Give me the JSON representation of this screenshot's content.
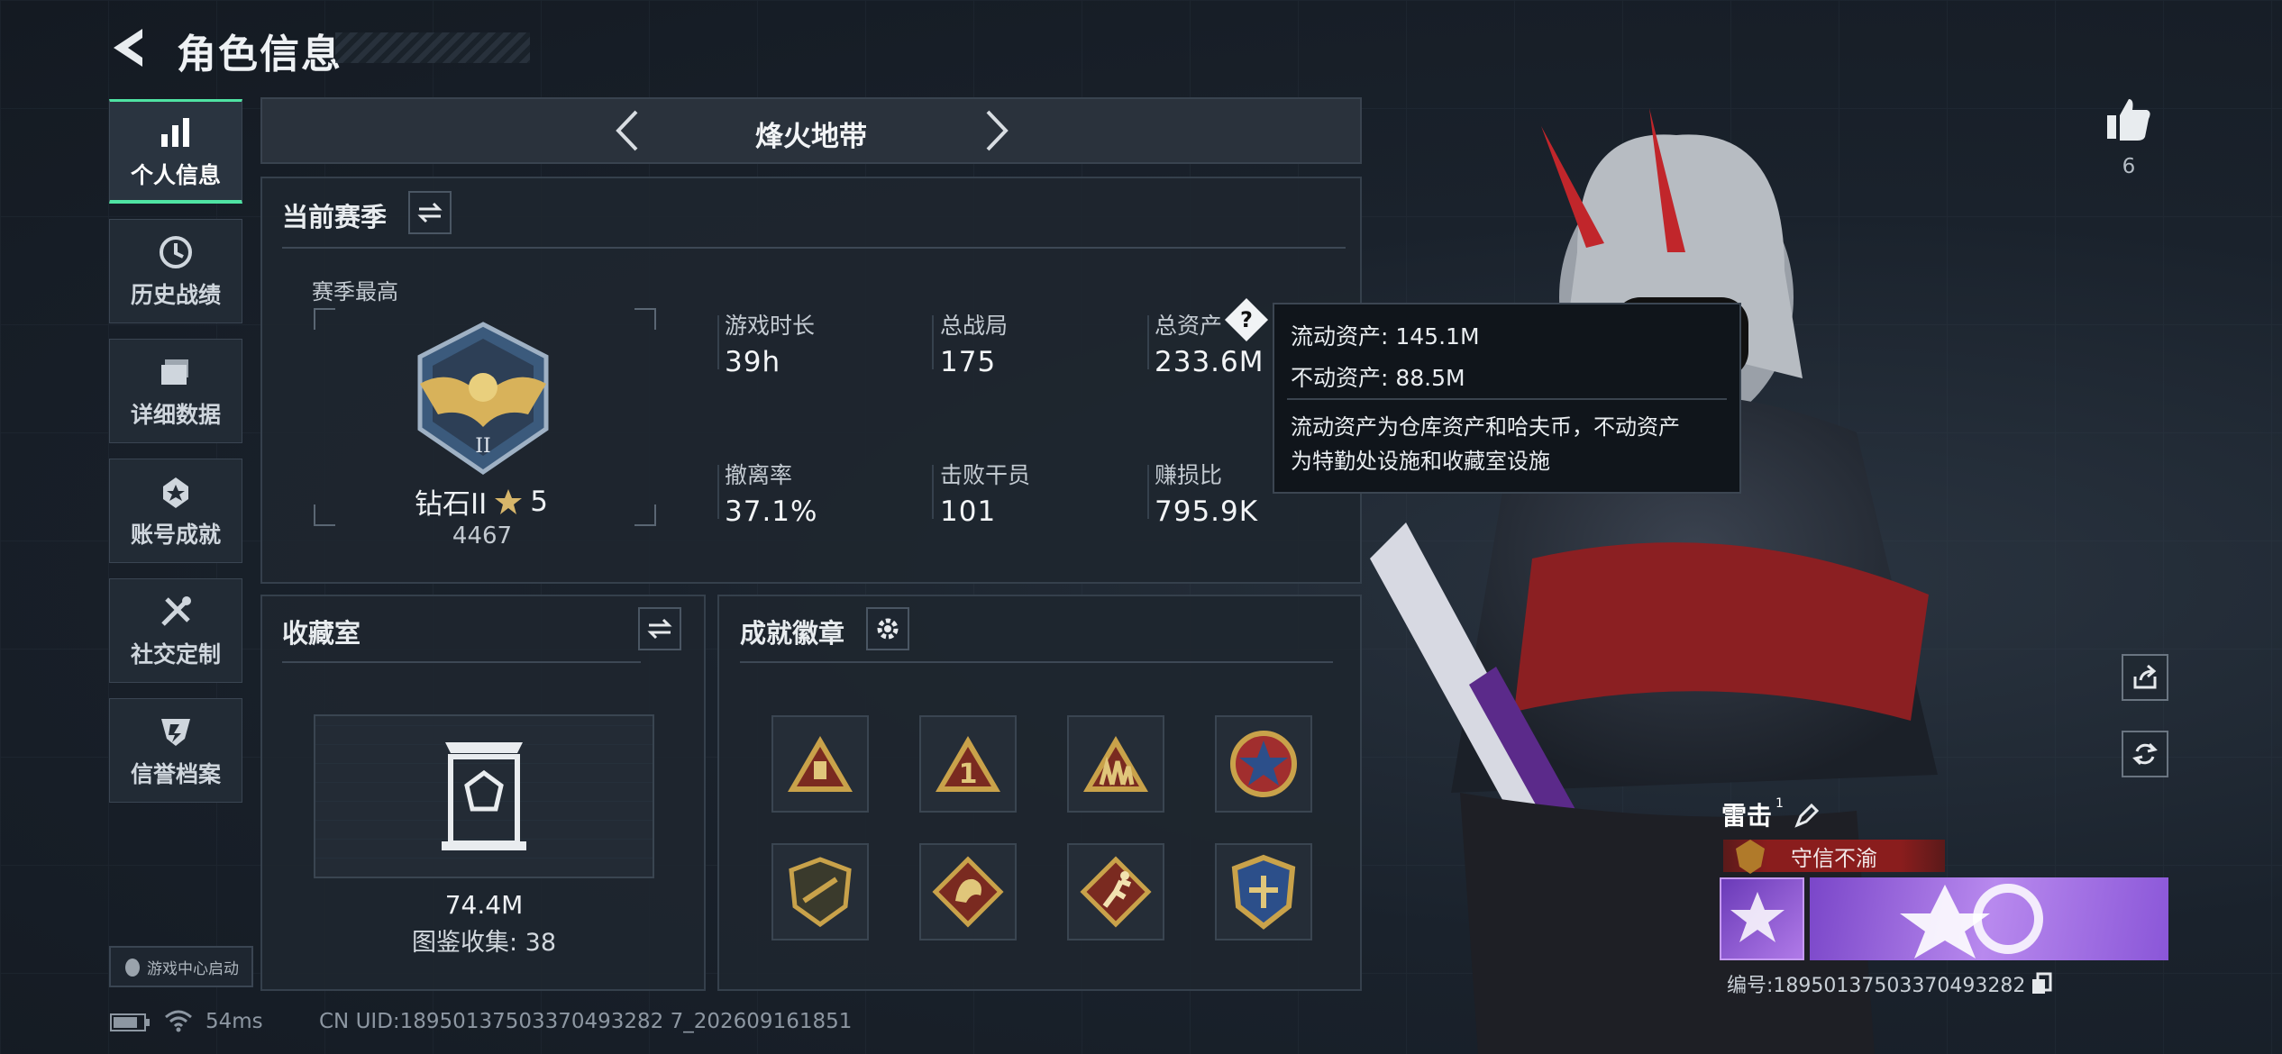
{
  "header": {
    "title": "角色信息"
  },
  "nav": {
    "items": [
      {
        "label": "个人信息",
        "icon": "bar-chart-icon"
      },
      {
        "label": "历史战绩",
        "icon": "clock-icon"
      },
      {
        "label": "详细数据",
        "icon": "folder-icon"
      },
      {
        "label": "账号成就",
        "icon": "medal-icon"
      },
      {
        "label": "社交定制",
        "icon": "tools-icon"
      },
      {
        "label": "信誉档案",
        "icon": "shield-icon"
      }
    ],
    "launcher": "游戏中心启动"
  },
  "mode": {
    "title": "烽火地带"
  },
  "season": {
    "title": "当前赛季",
    "best_label": "赛季最高",
    "rank": "钻石II",
    "stars": "5",
    "score": "4467",
    "stats": [
      {
        "label": "游戏时长",
        "value": "39h"
      },
      {
        "label": "总战局",
        "value": "175"
      },
      {
        "label": "总资产",
        "value": "233.6M"
      },
      {
        "label": "撤离率",
        "value": "37.1%"
      },
      {
        "label": "击败干员",
        "value": "101"
      },
      {
        "label": "赚损比",
        "value": "795.9K"
      }
    ]
  },
  "tooltip": {
    "liquid": "流动资产: 145.1M",
    "fixed": "不动资产: 88.5M",
    "desc_line1": "流动资产为仓库资产和哈夫币，不动资产",
    "desc_line2": "为特勤处设施和收藏室设施"
  },
  "collection": {
    "title": "收藏室",
    "value": "74.4M",
    "catalog": "图鉴收集: 38"
  },
  "achievements": {
    "title": "成就徽章",
    "badges": [
      "warning-badge",
      "number-one-badge",
      "squad-badge",
      "star-badge",
      "no-gun-badge",
      "dragon-badge",
      "runner-badge",
      "crest-badge"
    ]
  },
  "player": {
    "likes": "6",
    "name": "雷击",
    "name_sup": "1",
    "tag": "守信不渝",
    "id_text": "编号:18950137503370493282"
  },
  "status": {
    "ping": "54ms",
    "uid": "CN UID:18950137503370493282 7_202609161851"
  },
  "colors": {
    "accent": "#4fe3a3",
    "tag": "#8a1d1d",
    "banner": "#9a5fd8"
  }
}
